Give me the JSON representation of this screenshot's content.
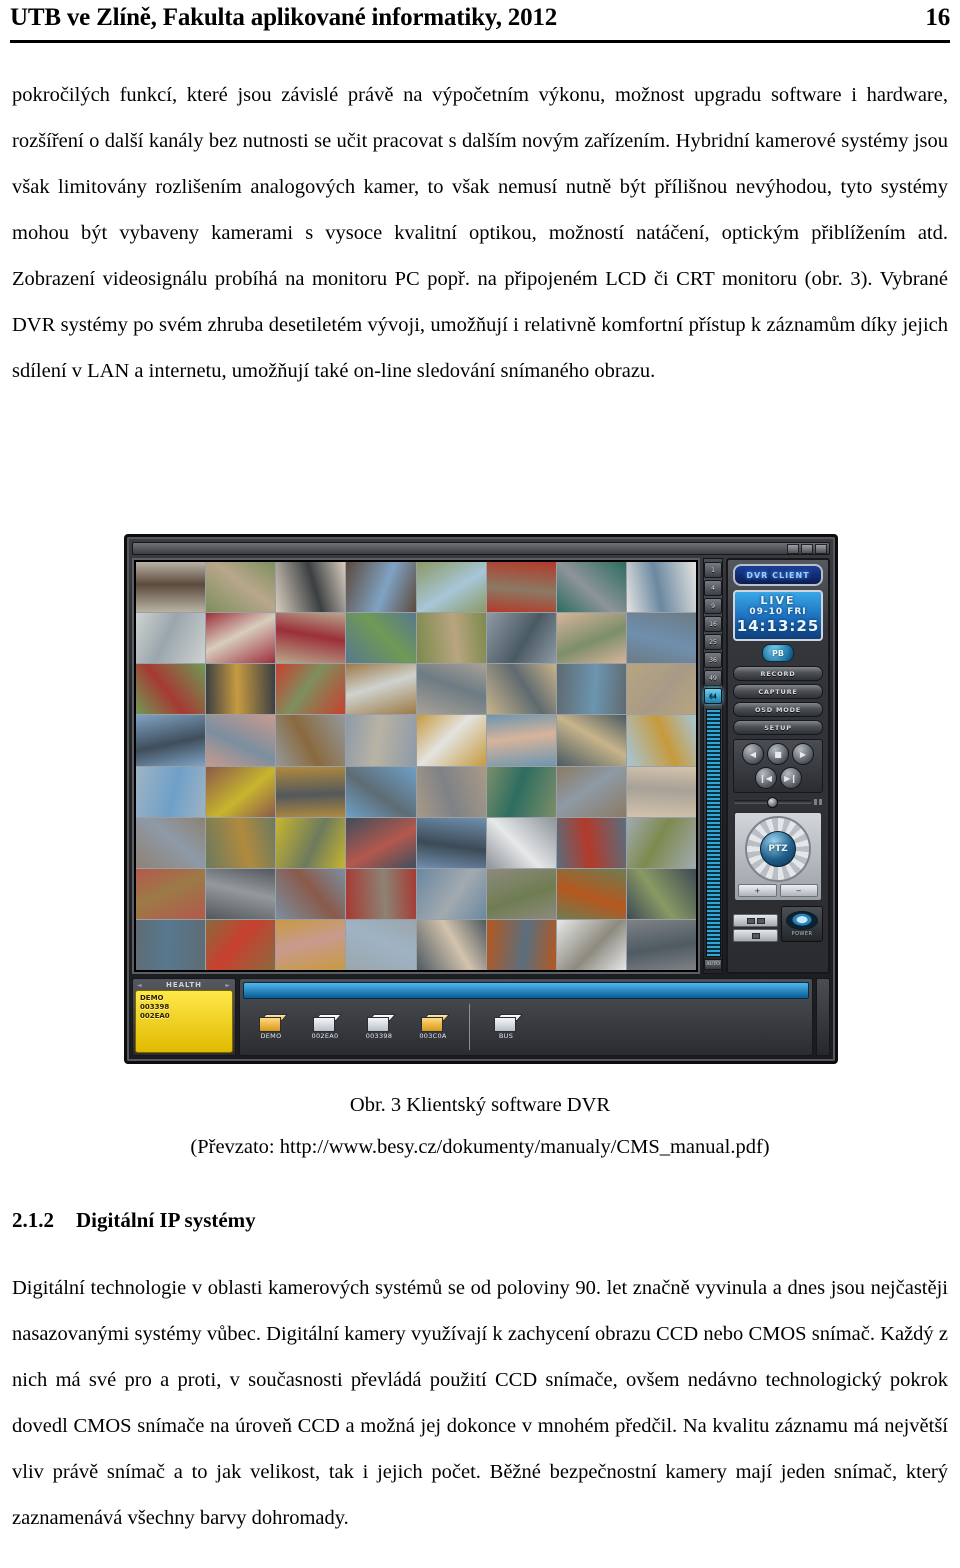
{
  "header": {
    "title": "UTB ve Zlíně, Fakulta aplikované informatiky, 2012",
    "page_number": "16"
  },
  "paragraphs": {
    "p1": "pokročilých funkcí, které jsou závislé právě na výpočetním výkonu, možnost upgradu software i hardware, rozšíření o další kanály bez nutnosti se učit pracovat s dalším novým zařízením. Hybridní kamerové systémy jsou však limitovány rozlišením analogových kamer, to však nemusí nutně být přílišnou nevýhodou, tyto systémy mohou být vybaveny kamerami s vysoce kvalitní optikou, možností natáčení, optickým přiblížením atd. Zobrazení videosignálu probíhá na monitoru PC popř. na připojeném LCD či CRT monitoru (obr. 3). Vybrané DVR systémy po svém zhruba desetiletém vývoji, umožňují i relativně komfortní přístup k záznamům díky jejich sdílení v LAN a internetu, umožňují také on-line sledování snímaného obrazu.",
    "p2": "Digitální technologie v oblasti kamerových systémů se od poloviny 90. let značně vyvinula a dnes jsou nejčastěji nasazovanými systémy vůbec. Digitální kamery využívají k zachycení obrazu CCD nebo CMOS snímač. Každý z nich má své pro a proti, v současnosti převládá použití CCD snímače, ovšem nedávno technologický pokrok dovedl CMOS snímače na úroveň CCD a možná jej dokonce v mnohém předčil. Na kvalitu záznamu má největší vliv právě snímač a to jak velikost, tak i jejich počet. Běžné bezpečnostní kamery mají jeden snímač, který zaznamenává všechny barvy dohromady."
  },
  "figure": {
    "caption_line1": "Obr. 3 Klientský software DVR",
    "caption_line2": "(Převzato: http://www.besy.cz/dokumenty/manualy/CMS_manual.pdf)",
    "dvr": {
      "brand": "DVR CLIENT",
      "lcd": {
        "mode": "LIVE",
        "date": "09-10  FRI",
        "time": "14:13:25"
      },
      "pb_label": "PB",
      "commands": [
        "RECORD",
        "CAPTURE",
        "OSD MODE",
        "SETUP"
      ],
      "transport_icons": [
        "◀",
        "■",
        "▶",
        "◀◀",
        "▶▶"
      ],
      "layout_buttons": [
        "1",
        "4",
        "9",
        "16",
        "25",
        "36",
        "49",
        "64"
      ],
      "layout_active": "64",
      "layout_footer": "AUTO",
      "ptz_label": "PTZ",
      "ptz_zoom": [
        "+",
        "−"
      ],
      "power_label": "POWER",
      "grid_rows": 8,
      "grid_cols": 8,
      "health": {
        "label": "HEALTH",
        "tab_lines": [
          "DEMO",
          "003398",
          "002EA0"
        ]
      },
      "devices": [
        {
          "name": "DEMO",
          "color": "yellow"
        },
        {
          "name": "002EA0",
          "color": "white"
        },
        {
          "name": "003398",
          "color": "white"
        },
        {
          "name": "003C0A",
          "color": "yellow"
        },
        {
          "name": "BUS",
          "color": "white"
        }
      ]
    }
  },
  "section": {
    "number": "2.1.2",
    "title": "Digitální IP systémy"
  },
  "colors": {
    "lcd_blue": "#2b8fd6",
    "accent_cyan": "#63d2f7",
    "health_yellow": "#ffe84a",
    "panel_gray": "#4a4d52"
  },
  "camera_tiles": [
    "#b9b3a4",
    "#7e8f5e",
    "#d8cdbd",
    "#5c4a3d",
    "#8a9a63",
    "#b33a2a",
    "#2d6d60",
    "#e3e3e0",
    "#cfd2cf",
    "#9c2f3a",
    "#b9a78c",
    "#57788f",
    "#7d8a4e",
    "#8e9aa5",
    "#d7b49a",
    "#6d7b84",
    "#6f9a55",
    "#3b3f42",
    "#c8402f",
    "#9c7a46",
    "#a8a196",
    "#c7b48a",
    "#5f6a70",
    "#b8a57f",
    "#7fa3c4",
    "#c99a8e",
    "#93999c",
    "#8e9aa8",
    "#c79a3d",
    "#6c95b0",
    "#4a5a63",
    "#a7c6d8",
    "#9fb3c4",
    "#8a5a4a",
    "#b08a3e",
    "#6ea0c8",
    "#a89a87",
    "#7c8e6a",
    "#8b7a64",
    "#d2c3ad",
    "#8d8274",
    "#6d7a5e",
    "#c8b52e",
    "#3f4e5c",
    "#6f8fae",
    "#8e949a",
    "#5a6e7e",
    "#a2aab0",
    "#b4584d",
    "#53585c",
    "#7b8fa0",
    "#a63a33",
    "#6a88a0",
    "#8d8a7e",
    "#6f7d52",
    "#3d4a56",
    "#5e6c74",
    "#8a6a3e",
    "#c79a42",
    "#9aa6ad",
    "#4f5a62",
    "#b5581f",
    "#e6e8e9",
    "#7e8287"
  ]
}
